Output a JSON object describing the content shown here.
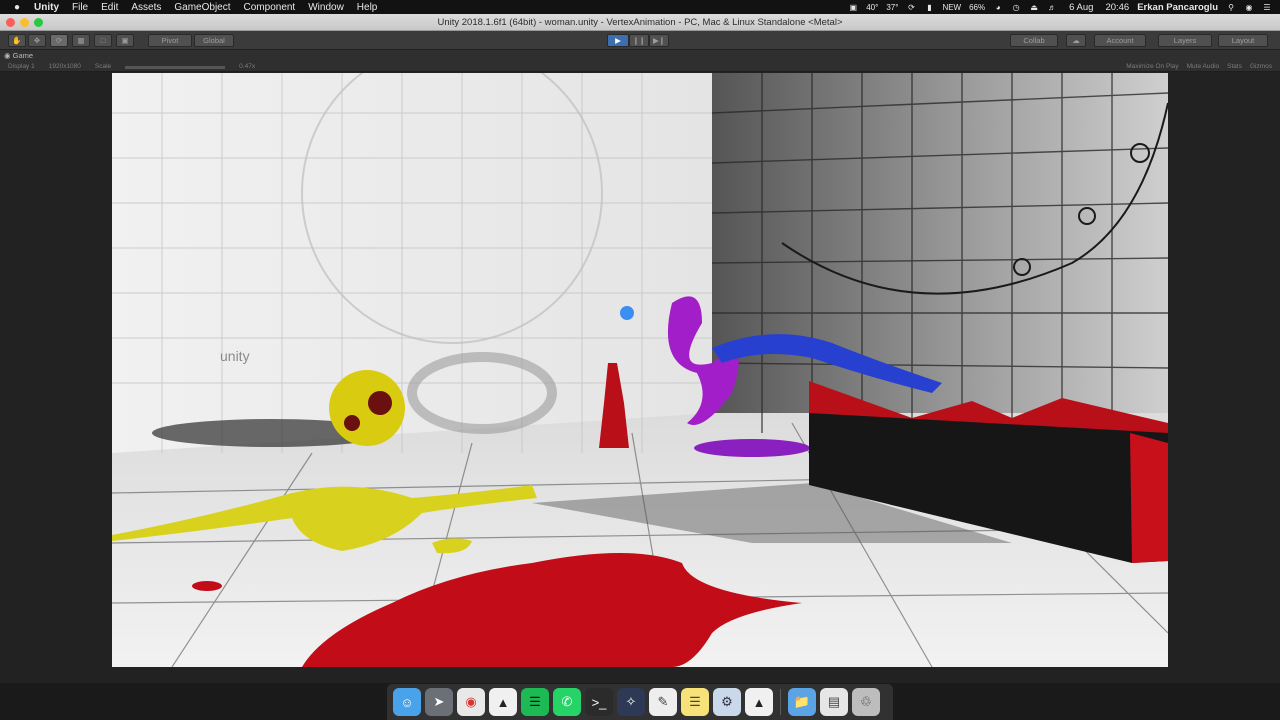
{
  "menubar": {
    "apple": "",
    "app_name": "Unity",
    "items": [
      "File",
      "Edit",
      "Assets",
      "GameObject",
      "Component",
      "Window",
      "Help"
    ]
  },
  "status": {
    "temp_gpu": "40°",
    "temp_cpu": "37°",
    "battery_label": "NEW",
    "battery_pct": "66%",
    "date": "6 Aug",
    "time": "20:46",
    "user": "Erkan Pancaroglu"
  },
  "window": {
    "title": "Unity 2018.1.6f1 (64bit) - woman.unity - VertexAnimation - PC, Mac & Linux Standalone <Metal>"
  },
  "toolbar": {
    "pivot": "Pivot",
    "global": "Global",
    "collab": "Collab",
    "account": "Account",
    "layers": "Layers",
    "layout": "Layout"
  },
  "game": {
    "tab": "Game",
    "display": "Display 1",
    "resolution": "1920x1080",
    "scale_label": "Scale",
    "scale_value": "0.47x",
    "maximize": "Maximize On Play",
    "mute": "Mute Audio",
    "stats": "Stats",
    "gizmos": "Gizmos"
  },
  "scene": {
    "logo_text": "unity"
  },
  "colors": {
    "red": "#c8101a",
    "yellow": "#d8d21e",
    "purple": "#a21ec8",
    "blue": "#2a46d8"
  }
}
